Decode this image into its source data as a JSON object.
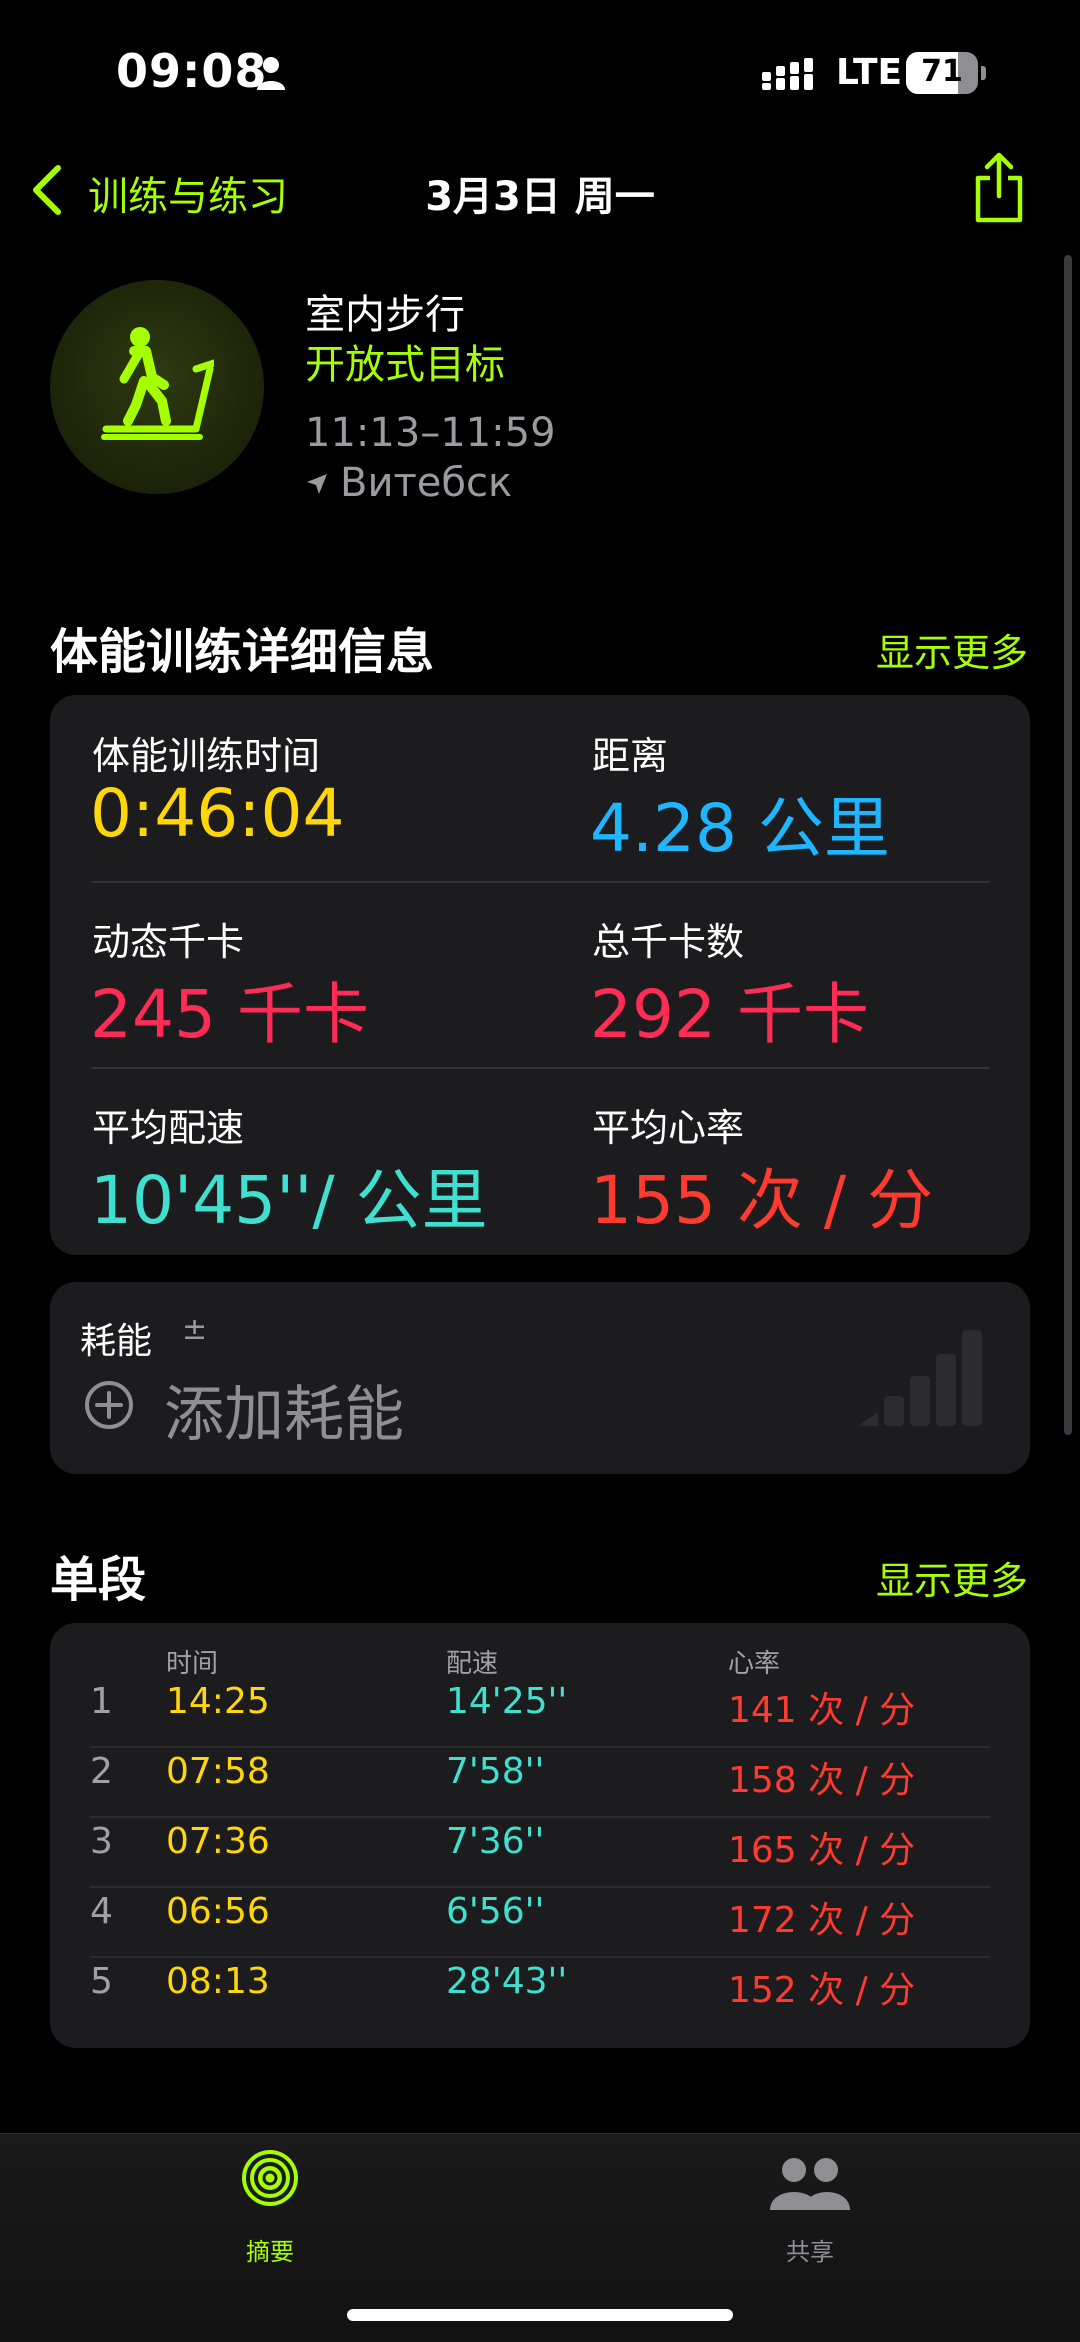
{
  "status": {
    "time": "09:08",
    "network": "LTE",
    "battery": "71"
  },
  "nav": {
    "back_label": "训练与练习",
    "title": "3月3日 周一"
  },
  "workout": {
    "type": "室内步行",
    "goal": "开放式目标",
    "time_range": "11:13–11:59",
    "location": "Витебск"
  },
  "details": {
    "title": "体能训练详细信息",
    "show_more": "显示更多",
    "metrics": [
      {
        "label": "体能训练时间",
        "value": "0:46:04",
        "color": "#ffd60a"
      },
      {
        "label": "距离",
        "value": "4.28 公里",
        "color": "#1fb6ff"
      },
      {
        "label": "动态千卡",
        "value": "245 千卡",
        "color": "#ff2d55"
      },
      {
        "label": "总千卡数",
        "value": "292 千卡",
        "color": "#ff2d55"
      },
      {
        "label": "平均配速",
        "value": "10'45''/ 公里",
        "color": "#40e0d0"
      },
      {
        "label": "平均心率",
        "value": "155 次 / 分",
        "color": "#ff3b30"
      }
    ]
  },
  "energy": {
    "label": "耗能",
    "modifier": "±",
    "add_label": "添加耗能"
  },
  "splits": {
    "title": "单段",
    "show_more": "显示更多",
    "headers": {
      "time": "时间",
      "pace": "配速",
      "hr": "心率"
    },
    "rows": [
      {
        "idx": "1",
        "time": "14:25",
        "pace": "14'25''",
        "hr": "141 次 / 分"
      },
      {
        "idx": "2",
        "time": "07:58",
        "pace": "7'58''",
        "hr": "158 次 / 分"
      },
      {
        "idx": "3",
        "time": "07:36",
        "pace": "7'36''",
        "hr": "165 次 / 分"
      },
      {
        "idx": "4",
        "time": "06:56",
        "pace": "6'56''",
        "hr": "172 次 / 分"
      },
      {
        "idx": "5",
        "time": "08:13",
        "pace": "28'43''",
        "hr": "152 次 / 分"
      }
    ]
  },
  "tabs": [
    {
      "label": "摘要",
      "color": "#a6ff00"
    },
    {
      "label": "共享",
      "color": "#8e8e93"
    }
  ],
  "colors": {
    "accent": "#a6ff00",
    "background": "#000000",
    "card": "#1c1c1e"
  }
}
